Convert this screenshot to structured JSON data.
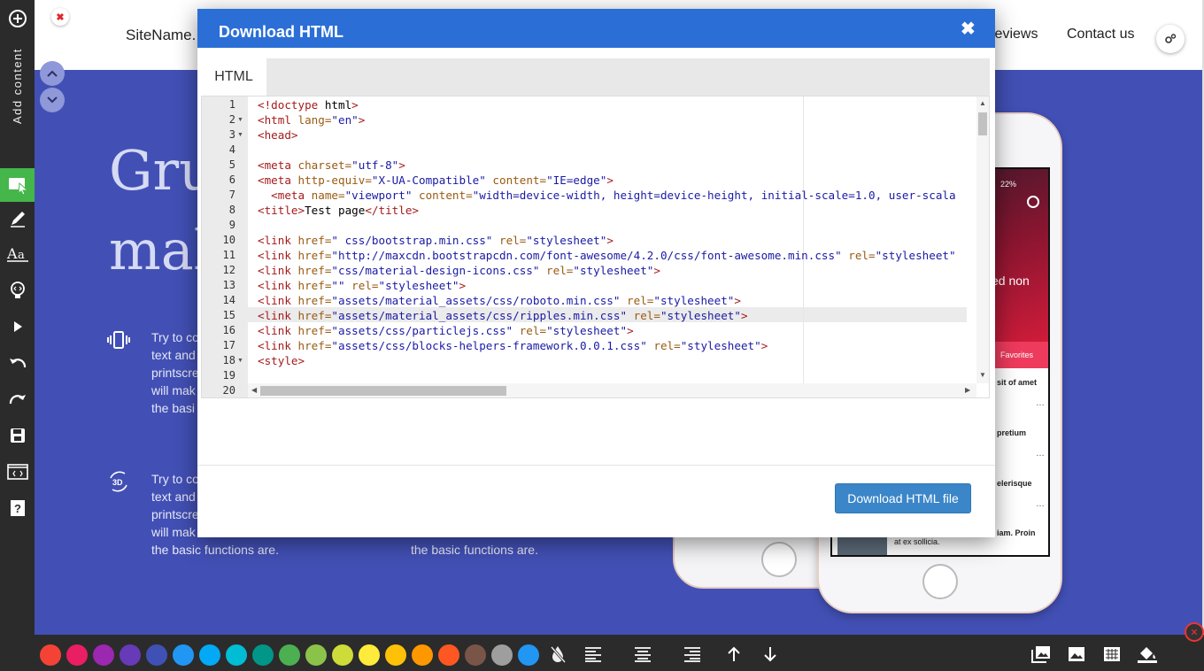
{
  "site": {
    "name": "SiteName.",
    "nav": {
      "reviews": "Reviews",
      "contact": "Contact us"
    },
    "hero_heading_line1": "Gru",
    "hero_heading_line2": "mal",
    "features": [
      {
        "lines": [
          "Try to co",
          "text and",
          "printscre",
          "will mak",
          "the basi"
        ]
      },
      {
        "lines": [
          "Try to co",
          "text and",
          "printscre",
          "will mak",
          "the basic functions are."
        ]
      }
    ],
    "second_column_text": "the basic functions are.",
    "phone": {
      "status": "22%",
      "title": "ed non",
      "favorites": "Favorites",
      "items": [
        "sit of amet",
        "pretium",
        "elerisque",
        "iam. Proin"
      ],
      "bottom_text": "at ex sollicia.",
      "icon_3d": "3D"
    }
  },
  "sidebar": {
    "add_content_label": "Add content",
    "tools": [
      "add-icon",
      "select-block-icon",
      "pen-icon",
      "text-style-icon",
      "bulb-code-icon",
      "preview-play-icon",
      "undo-icon",
      "redo-icon",
      "save-icon",
      "code-window-icon",
      "help-icon"
    ]
  },
  "colors": {
    "swatches": [
      "#f44336",
      "#e91e63",
      "#9c27b0",
      "#673ab7",
      "#3f51b5",
      "#2196f3",
      "#03a9f4",
      "#00bcd4",
      "#009688",
      "#4caf50",
      "#8bc34a",
      "#cddc39",
      "#ffeb3b",
      "#ffc107",
      "#ff9800",
      "#ff5722",
      "#795548",
      "#9e9e9e",
      "#2196f3"
    ],
    "modal_header": "#2b6fd6",
    "download_button": "#3b86c8"
  },
  "modal": {
    "title": "Download HTML",
    "close": "✖",
    "tab": "HTML",
    "download_button": "Download HTML file",
    "line_numbers": [
      "1",
      "2",
      "3",
      "4",
      "5",
      "6",
      "7",
      "8",
      "9",
      "10",
      "11",
      "12",
      "13",
      "14",
      "15",
      "16",
      "17",
      "18",
      "19",
      "20"
    ],
    "code": [
      "<!doctype html>",
      "<html lang=\"en\">",
      "<head>",
      "",
      "<meta charset=\"utf-8\">",
      "<meta http-equiv=\"X-UA-Compatible\" content=\"IE=edge\">",
      "  <meta name=\"viewport\" content=\"width=device-width, height=device-height, initial-scale=1.0, user-scala",
      "<title>Test page</title>",
      "",
      "<link href=\" css/bootstrap.min.css\" rel=\"stylesheet\">",
      "<link href=\"http://maxcdn.bootstrapcdn.com/font-awesome/4.2.0/css/font-awesome.min.css\" rel=\"stylesheet\"",
      "<link href=\"css/material-design-icons.css\" rel=\"stylesheet\">",
      "<link href=\"\" rel=\"stylesheet\">",
      "<link href=\"assets/material_assets/css/roboto.min.css\" rel=\"stylesheet\">",
      "<link href=\"assets/material_assets/css/ripples.min.css\" rel=\"stylesheet\">",
      "<link href=\"assets/css/particlejs.css\" rel=\"stylesheet\">",
      "<link href=\"assets/css/blocks-helpers-framework.0.0.1.css\" rel=\"stylesheet\">",
      "<style>",
      "",
      ""
    ]
  }
}
